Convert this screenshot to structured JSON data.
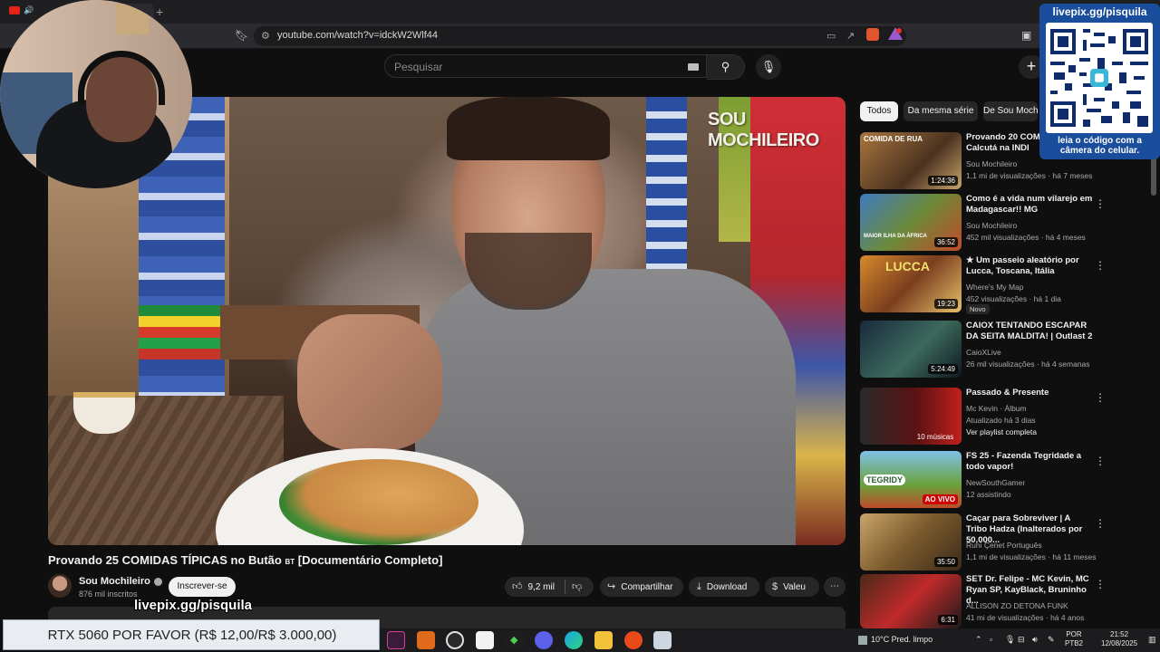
{
  "browser": {
    "url": "youtube.com/watch?v=idckW2Wlf44"
  },
  "header": {
    "search_placeholder": "Pesquisar"
  },
  "video": {
    "watermark": "SOU MOCHILEIRO",
    "title": "Provando 25 COMIDAS TÍPICAS no Butão",
    "title_flag": "BT",
    "title_suffix": "[Documentário Completo]",
    "channel": "Sou Mochileiro",
    "subscribers": "876 mil inscritos",
    "subscribe_label": "Inscrever-se",
    "likes": "9,2 mil",
    "share_label": "Compartilhar",
    "download_label": "Download",
    "thanks_label": "Valeu"
  },
  "sidebar": {
    "chips": [
      "Todos",
      "Da mesma série",
      "De Sou Moch"
    ],
    "items": [
      {
        "title": "Provando 20 COMII em Calcutá na INDI",
        "channel": "Sou Mochileiro",
        "meta": "1,1 mi de visualizações · há 7 meses",
        "duration": "1:24:36",
        "thumb_text": "COMIDA DE RUA"
      },
      {
        "title": "Como é a vida num vilarejo em Madagascar!! MG",
        "channel": "Sou Mochileiro",
        "meta": "452 mil visualizações · há 4 meses",
        "duration": "36:52",
        "thumb_text": "MAIOR ILHA DA ÁFRICA"
      },
      {
        "title": "★ Um passeio aleatório por Lucca, Toscana, Itália",
        "channel": "Where's My Map",
        "meta": "452 visualizações · há 1 dia",
        "duration": "19:23",
        "badge": "Novo",
        "thumb_text": "LUCCA"
      },
      {
        "title": "CAIOX TENTANDO ESCAPAR DA SEITA MALDITA! | Outlast 2",
        "channel": "CaioXLive",
        "meta": "26 mil visualizações · há 4 semanas",
        "duration": "5:24:49"
      },
      {
        "title": "Passado & Presente",
        "channel": "Mc Kevin · Álbum",
        "meta": "Atualizado há 3 dias",
        "meta2": "Ver playlist completa",
        "playlist": "10 músicas"
      },
      {
        "title": "FS 25 - Fazenda Tegridade a todo vapor!",
        "channel": "NewSouthGamer",
        "meta": "12 assistindo",
        "live": "AO VIVO",
        "thumb_text": "TEGRIDY"
      },
      {
        "title": "Caçar para Sobreviver | A Tribo Hadza (Inalterados por 50.000...",
        "channel": "Ruhi Çenet Português",
        "meta": "1,1 mi de visualizações · há 11 meses",
        "duration": "35:50"
      },
      {
        "title": "SET Dr. Felipe - MC Kevin, MC Ryan SP, KayBlack, Bruninho d...",
        "channel": "ALLISON ZO DETONA FUNK",
        "meta": "41 mi de visualizações · há 4 anos",
        "duration": "6:31"
      }
    ]
  },
  "overlay": {
    "qr_top": "livepix.gg/pisquila",
    "qr_bottom_1": "leia o código com a",
    "qr_bottom_2": "câmera do celular.",
    "donate_url": "livepix.gg/pisquila",
    "goal": "RTX 5060 POR FAVOR (R$ 12,00/R$ 3.000,00)"
  },
  "taskbar": {
    "weather": "10°C  Pred. limpo",
    "lang_1": "POR",
    "lang_2": "PTB2",
    "time": "21:52",
    "date": "12/08/2025"
  },
  "colors": {
    "background": "#0f0f0f",
    "chip_active": "#f1f1f1",
    "live_badge": "#cc0000",
    "qr_panel": "#1a4d9c"
  }
}
